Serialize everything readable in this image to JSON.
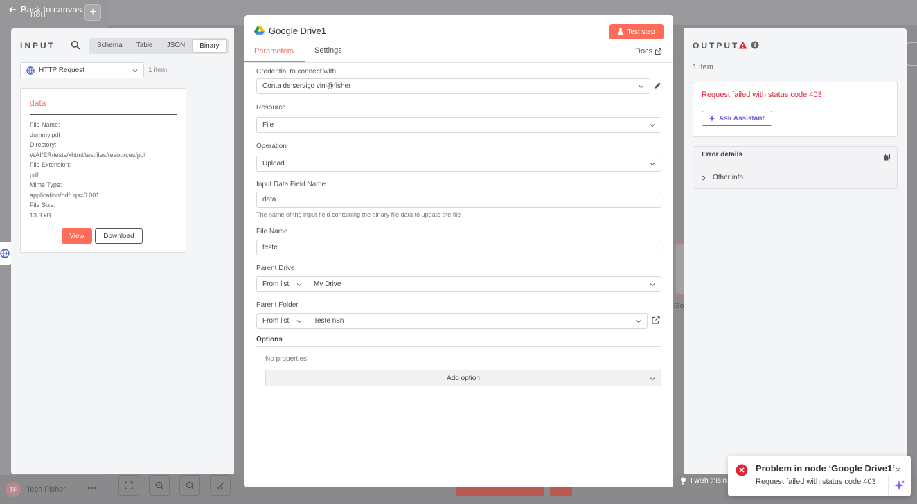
{
  "canvas": {
    "back_label": "Back to canvas",
    "workflow_name": "n8n",
    "add_label": "+",
    "user_name": "Tech Fisher",
    "user_initials": "TF",
    "feedback_text": "I wish this n",
    "node_peek_label": "Go"
  },
  "input": {
    "title": "INPUT",
    "tabs": [
      "Schema",
      "Table",
      "JSON",
      "Binary"
    ],
    "active_tab": "Binary",
    "source_node": "HTTP Request",
    "item_count": "1 item",
    "card": {
      "title": "data",
      "fields": [
        {
          "key": "File Name:",
          "value": "dummy.pdf"
        },
        {
          "key": "Directory:",
          "value": "WAI/ER/tests/xhtml/testfiles/resources/pdf"
        },
        {
          "key": "File Extension:",
          "value": "pdf"
        },
        {
          "key": "Mime Type:",
          "value": "application/pdf; qs=0.001"
        },
        {
          "key": "File Size:",
          "value": "13.3 kB"
        }
      ],
      "view_label": "View",
      "download_label": "Download"
    }
  },
  "modal": {
    "node_name": "Google Drive1",
    "test_label": "Test step",
    "tabs": [
      "Parameters",
      "Settings"
    ],
    "docs_label": "Docs",
    "fields": {
      "credential": {
        "label": "Credential to connect with",
        "value": "Conta de serviço vini@fisher"
      },
      "resource": {
        "label": "Resource",
        "value": "File"
      },
      "operation": {
        "label": "Operation",
        "value": "Upload"
      },
      "input_field": {
        "label": "Input Data Field Name",
        "value": "data",
        "hint": "The name of the input field containing the binary file data to update the file"
      },
      "file_name": {
        "label": "File Name",
        "value": "teste"
      },
      "parent_drive": {
        "label": "Parent Drive",
        "mode": "From list",
        "value": "My Drive"
      },
      "parent_folder": {
        "label": "Parent Folder",
        "mode": "From list",
        "value": "Teste n8n"
      }
    },
    "options": {
      "label": "Options",
      "empty": "No properties",
      "add_label": "Add option"
    }
  },
  "output": {
    "title": "OUTPUT",
    "item_count": "1 item",
    "error_message": "Request failed with status code 403",
    "assistant_label": "Ask Assistant",
    "details_title": "Error details",
    "other_info": "Other info"
  },
  "toast": {
    "title": "Problem in node ‘Google Drive1‘",
    "message": "Request failed with status code 403"
  },
  "colors": {
    "accent": "#ff6d5a",
    "error": "#e0273a",
    "assistant": "#7b5ce8"
  }
}
